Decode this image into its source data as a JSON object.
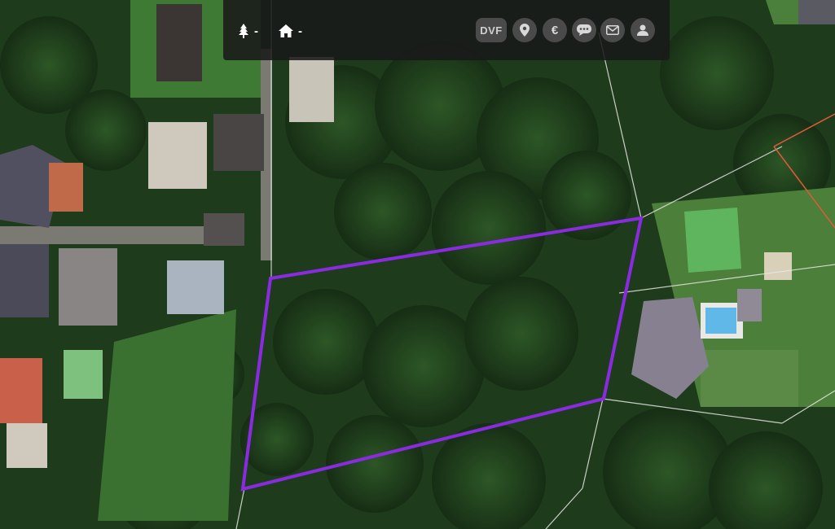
{
  "toolbar": {
    "tree_count": "-",
    "house_count": "-",
    "dvf_label": "DVF",
    "euro_symbol": "€"
  },
  "map": {
    "parcel_outline_color": "#8a2be2",
    "cadastre_line_color": "#e8e8e8",
    "neighbor_parcel_color": "#e05a3a"
  },
  "icons": [
    "tree-icon",
    "house-icon",
    "dvf-icon",
    "location-pin-icon",
    "euro-icon",
    "chat-icon",
    "mail-icon",
    "user-icon"
  ]
}
